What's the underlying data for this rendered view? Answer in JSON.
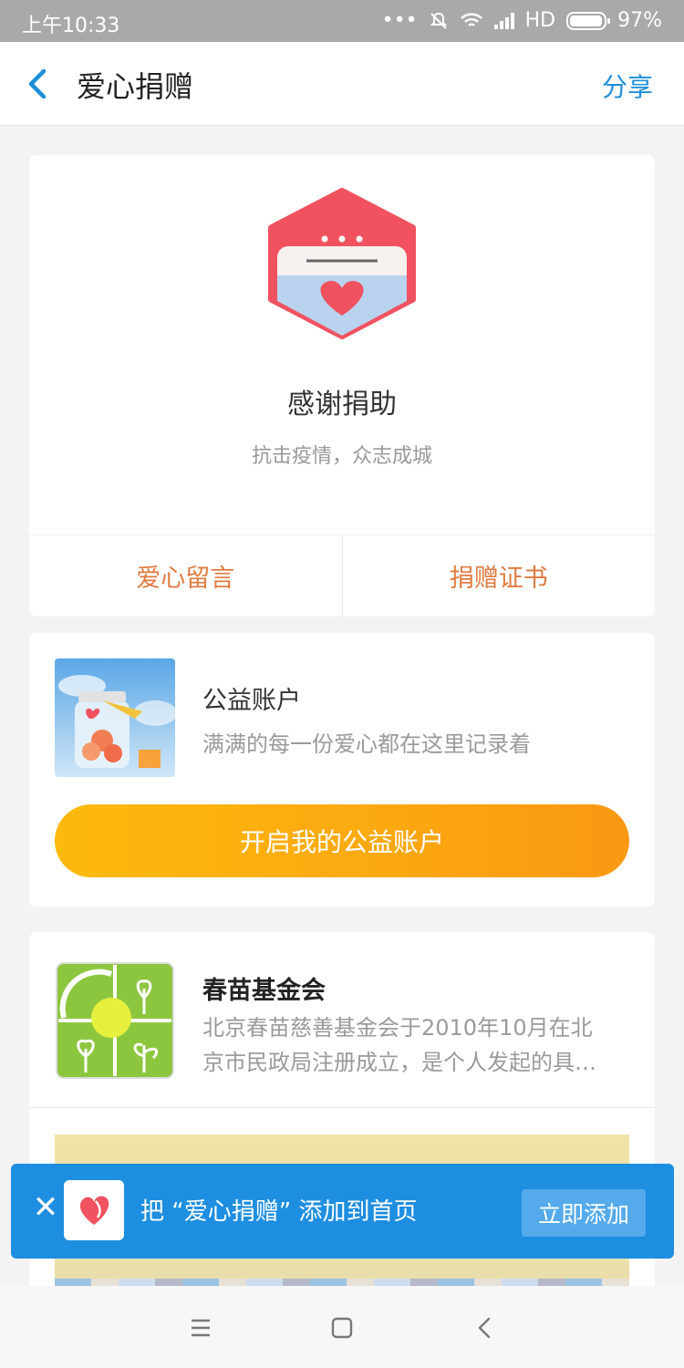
{
  "status_bar": {
    "time": "上午10:33",
    "network": "HD",
    "battery": "97%",
    "battery_level": 0.97
  },
  "nav": {
    "back_icon": "chevron-left-icon",
    "title": "爱心捐赠",
    "share": "分享"
  },
  "thanks_card": {
    "icon": "donation-box-heart-icon",
    "title": "感谢捐助",
    "subtitle": "抗击疫情，众志成城",
    "actions": [
      "爱心留言",
      "捐赠证书"
    ]
  },
  "account_card": {
    "image": "heart-jar-illustration",
    "title": "公益账户",
    "description": "满满的每一份爱心都在这里记录着",
    "button": "开启我的公益账户"
  },
  "foundation_card": {
    "logo": "sprout-logo",
    "name": "春苗基金会",
    "description_line1": "北京春苗慈善基金会于2010年10月在北",
    "description_line2": "京市民政局注册成立，是个人发起的具…"
  },
  "banner": {
    "close_icon": "close-icon",
    "app_icon": "heart-app-icon",
    "message": "把 “爱心捐赠” 添加到首页",
    "button": "立即添加"
  },
  "colors": {
    "accent_blue": "#1e8fd6",
    "action_orange": "#e07b3f",
    "button_yellow": "#fdb90d",
    "heart_red": "#f0525f"
  }
}
